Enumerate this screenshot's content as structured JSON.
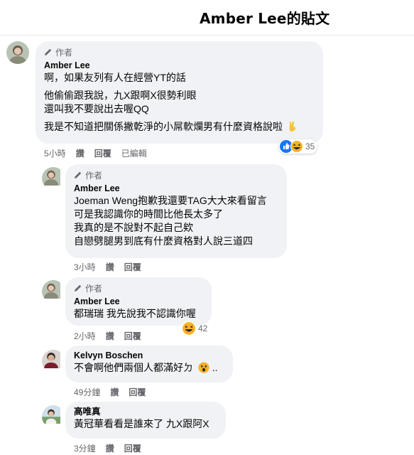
{
  "post": {
    "title": "Amber Lee的貼文"
  },
  "comments": [
    {
      "badge": "作者",
      "author": "Amber Lee",
      "lines": [
        "啊，如果友列有人在經營YT的話",
        "他偷偷跟我說，九X跟啊X很勢利眼",
        "還叫我不要說出去喔QQ",
        "我是不知道把關係撇乾淨的小屌軟爛男有什麼資格說啦"
      ],
      "time": "5小時",
      "actions": [
        "讚",
        "回覆",
        "已編輯"
      ],
      "reaction_count": "35",
      "reaction_icons": [
        "like-icon",
        "haha-icon"
      ]
    },
    {
      "badge": "作者",
      "author": "Amber Lee",
      "lines": [
        "Joeman Weng抱歉我還要TAG大大來看留言",
        "可是我認識你的時間比他長太多了",
        "我真的是不說對不起自己欸",
        "自戀劈腿男到底有什麼資格對人說三道四"
      ],
      "time": "3小時",
      "actions": [
        "讚",
        "回覆"
      ]
    },
    {
      "badge": "作者",
      "author": "Amber Lee",
      "lines": [
        "都瑞瑞 我先說我不認識你喔"
      ],
      "time": "2小時",
      "actions": [
        "讚",
        "回覆"
      ],
      "reaction_count": "42",
      "reaction_icons": [
        "haha-icon"
      ]
    },
    {
      "author": "Kelvyn Boschen",
      "lines": [
        "不會啊他們兩個人都滿好ㄉ",
        ".."
      ],
      "time": "49分鐘",
      "actions": [
        "讚",
        "回覆"
      ]
    },
    {
      "author": "高唯真",
      "lines": [
        "黃冠華看看是誰來了 九X跟阿X"
      ],
      "time": "3分鐘",
      "actions": [
        "讚",
        "回覆"
      ]
    }
  ],
  "colors": {
    "bubble": "#f0f2f5",
    "meta": "#65676b",
    "like_blue": "#1877f2",
    "haha_yellow": "#f7b125"
  }
}
